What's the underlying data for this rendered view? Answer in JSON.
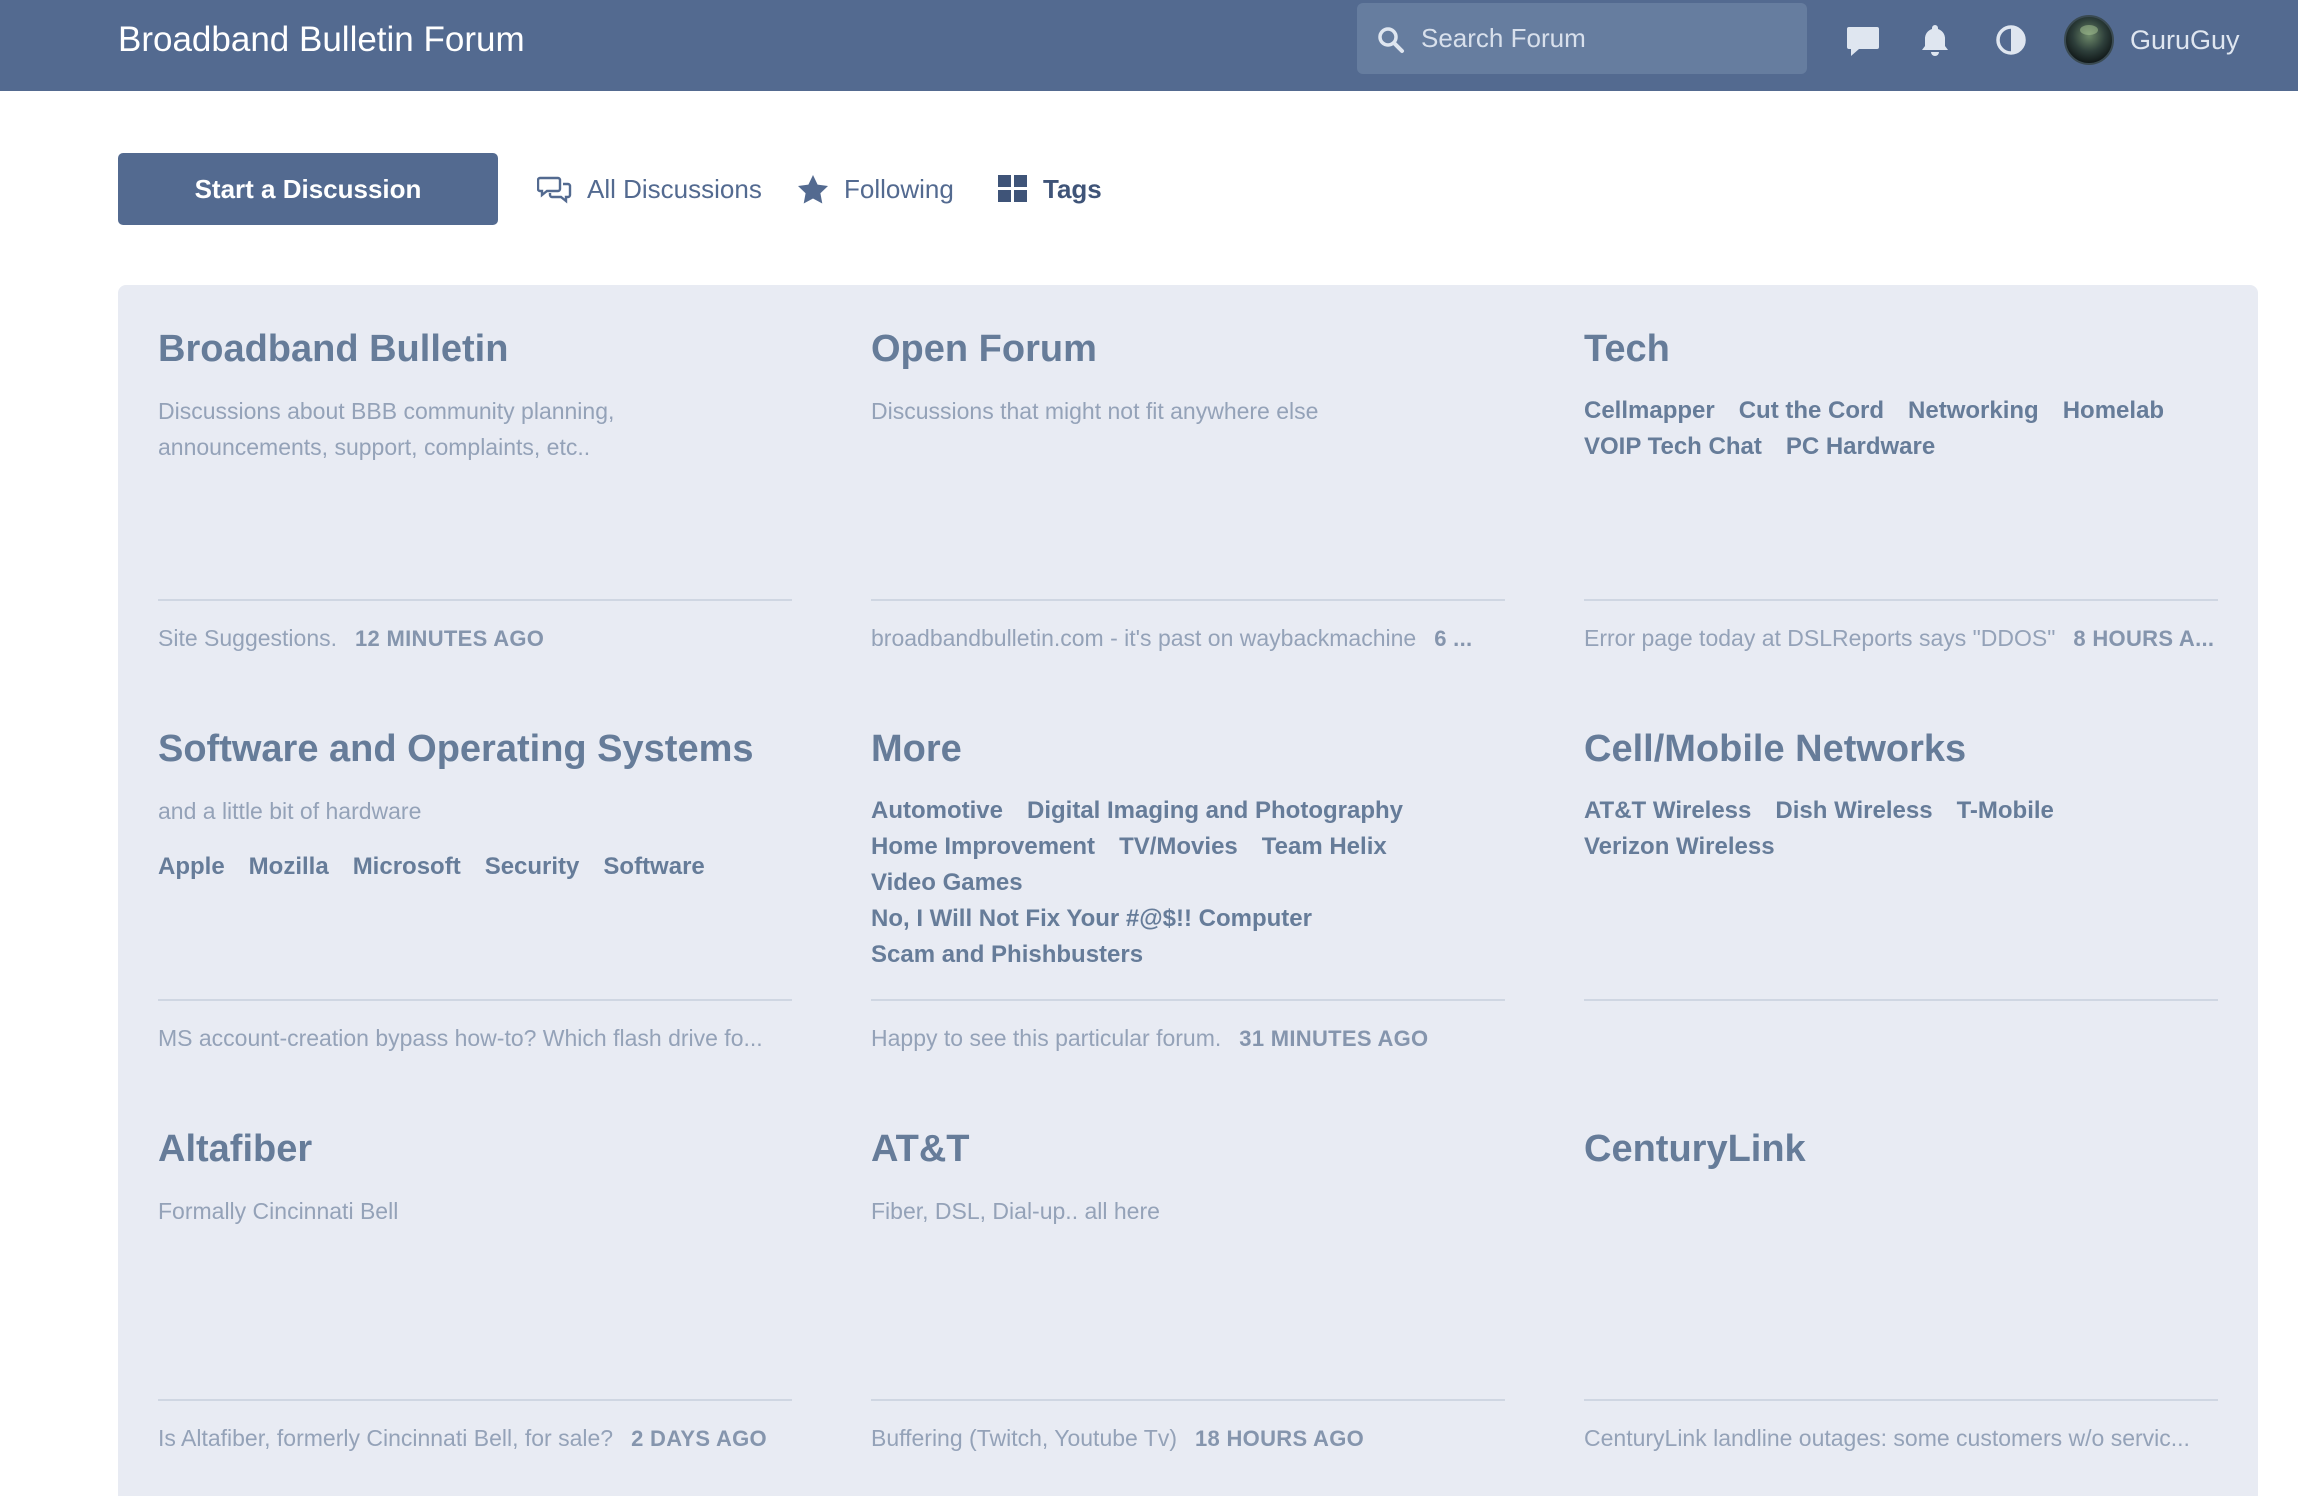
{
  "header": {
    "brand": "Broadband Bulletin Forum",
    "search_placeholder": "Search Forum",
    "username": "GuruGuy",
    "icons": [
      "search-icon",
      "chat-icon",
      "bell-icon",
      "contrast-icon"
    ]
  },
  "toolbar": {
    "start_label": "Start a Discussion",
    "all_discussions": "All Discussions",
    "following": "Following",
    "tags": "Tags"
  },
  "colors": {
    "header_bg": "#536a90",
    "panel_bg": "#e8ebf3",
    "title_text": "#667c99",
    "muted_text": "#94a2b8"
  },
  "tags": [
    {
      "title": "Broadband Bulletin",
      "description": "Discussions about BBB community planning, announcements, support, complaints, etc..",
      "children": [],
      "last_title": "Site Suggestions.",
      "last_time": "12 MINUTES AGO"
    },
    {
      "title": "Open Forum",
      "description": "Discussions that might not fit anywhere else",
      "children": [],
      "last_title": "broadbandbulletin.com - it's past on waybackmachine",
      "last_time": "6 ..."
    },
    {
      "title": "Tech",
      "description": "",
      "children": [
        "Cellmapper",
        "Cut the Cord",
        "Networking",
        "Homelab",
        "VOIP Tech Chat",
        "PC Hardware"
      ],
      "last_title": "Error page today at DSLReports says \"DDOS\"",
      "last_time": "8 HOURS A..."
    },
    {
      "title": "Software and Operating Systems",
      "description": "and a little bit of hardware",
      "children": [
        "Apple",
        "Mozilla",
        "Microsoft",
        "Security",
        "Software"
      ],
      "last_title": "MS account-creation bypass how-to? Which flash drive fo...",
      "last_time": ""
    },
    {
      "title": "More",
      "description": "",
      "children": [
        "Automotive",
        "Digital Imaging and Photography",
        "Home Improvement",
        "TV/Movies",
        "Team Helix",
        "Video Games",
        "No, I Will Not Fix Your #@$!! Computer",
        "Scam and Phishbusters"
      ],
      "last_title": "Happy to see this particular forum.",
      "last_time": "31 MINUTES AGO"
    },
    {
      "title": "Cell/Mobile Networks",
      "description": "",
      "children": [
        "AT&T Wireless",
        "Dish Wireless",
        "T-Mobile",
        "Verizon Wireless"
      ],
      "last_title": "",
      "last_time": ""
    },
    {
      "title": "Altafiber",
      "description": "Formally Cincinnati Bell",
      "children": [],
      "last_title": "Is Altafiber, formerly Cincinnati Bell, for sale?",
      "last_time": "2 DAYS AGO"
    },
    {
      "title": "AT&T",
      "description": "Fiber, DSL, Dial-up.. all here",
      "children": [],
      "last_title": "Buffering (Twitch, Youtube Tv)",
      "last_time": "18 HOURS AGO"
    },
    {
      "title": "CenturyLink",
      "description": "",
      "children": [],
      "last_title": "CenturyLink landline outages: some customers w/o servic...",
      "last_time": ""
    }
  ]
}
